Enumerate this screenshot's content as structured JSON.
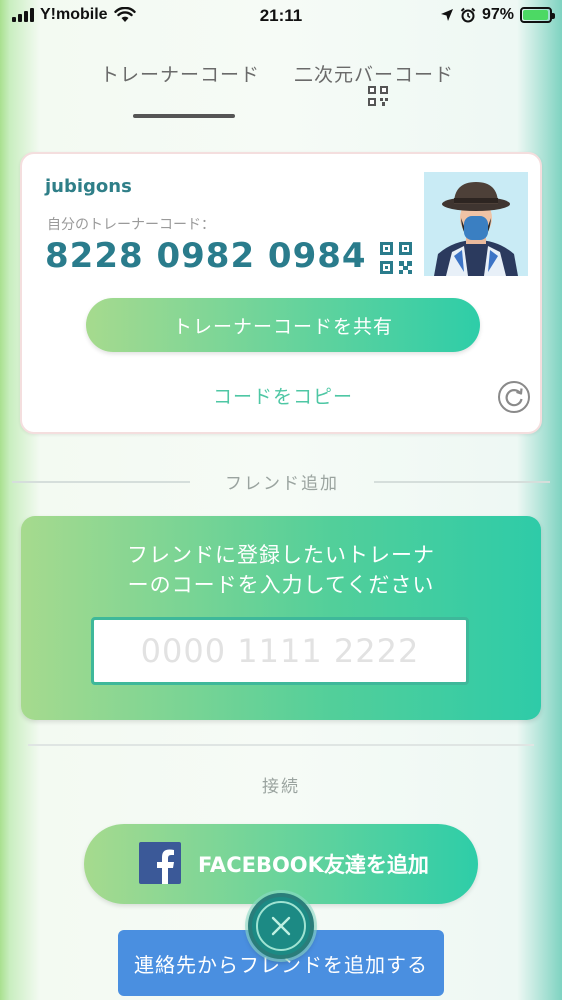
{
  "status_bar": {
    "carrier": "Y!mobile",
    "time": "21:11",
    "battery_percent": "97%",
    "battery_level": 0.97
  },
  "tabs": [
    {
      "label": "トレーナーコード",
      "active": true
    },
    {
      "label": "二次元バーコード",
      "active": false
    }
  ],
  "trainer": {
    "name": "jubigons",
    "code_label": "自分のトレーナーコード：",
    "code": "8228 0982 0984",
    "share_label": "トレーナーコードを共有",
    "copy_label": "コードをコピー"
  },
  "friend_add": {
    "title": "フレンド追加",
    "instruction_line1": "フレンドに登録したいトレーナ",
    "instruction_line2": "ーのコードを入力してください",
    "input_placeholder": "0000 1111 2222",
    "input_value": ""
  },
  "connect": {
    "title": "接続",
    "facebook_label": "FACEBOOK友達を追加",
    "contacts_label": "連絡先からフレンドを追加する"
  },
  "colors": {
    "accent_green": "#2ecda8",
    "code_teal": "#2a7c8c",
    "contacts_blue": "#4a8fe0",
    "facebook_blue": "#3b5998"
  },
  "icons": {
    "qr": "qr-code-icon",
    "refresh": "refresh-icon",
    "close": "close-icon",
    "facebook": "facebook-icon"
  }
}
